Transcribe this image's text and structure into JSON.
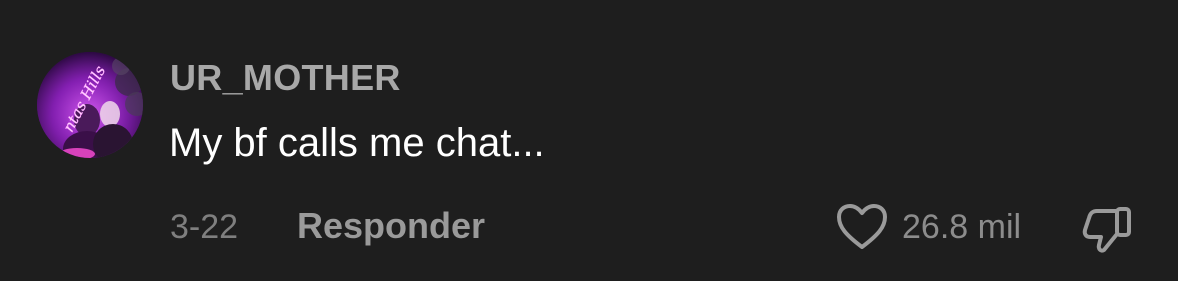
{
  "comment": {
    "username": "UR_MOTHER",
    "text": "My bf calls me chat...",
    "date": "3-22",
    "reply_label": "Responder",
    "like_count": "26.8 mil",
    "avatar_text": "ntas Hills",
    "icons": {
      "like": "heart-icon",
      "dislike": "thumbs-down-icon"
    }
  },
  "colors": {
    "background": "#1e1e1e",
    "username": "#a8a8a8",
    "text": "#ffffff",
    "muted": "#8c8c8c"
  }
}
